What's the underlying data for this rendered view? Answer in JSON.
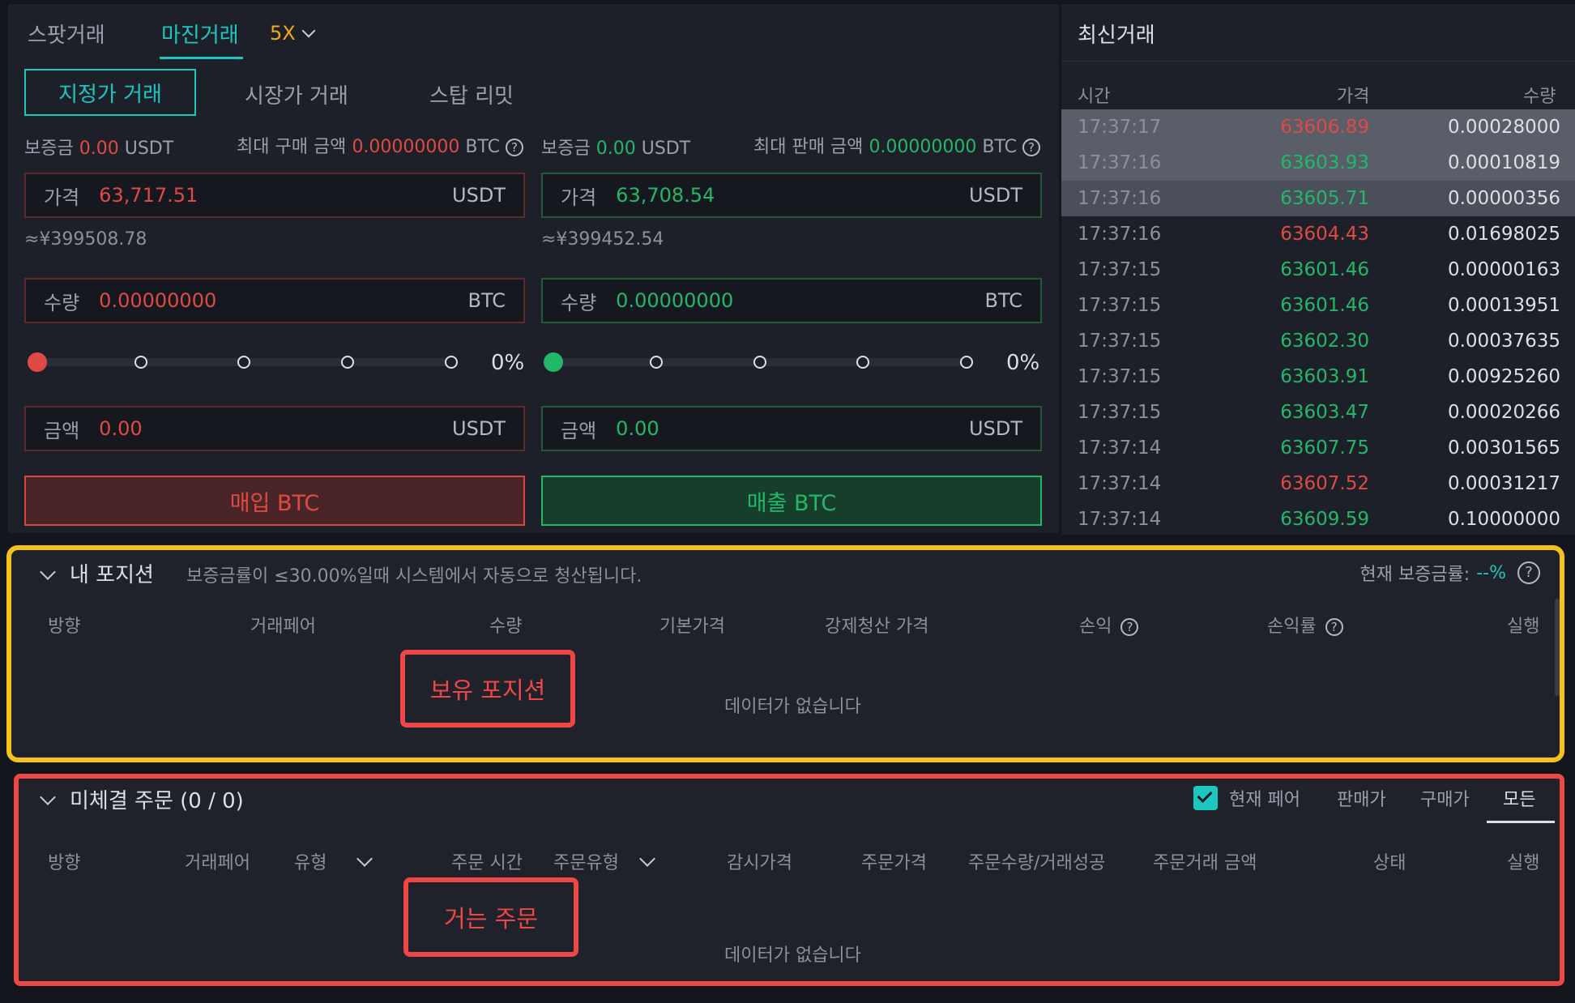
{
  "trade": {
    "tabs": {
      "spot": "스팟거래",
      "margin": "마진거래",
      "leverage": "5X"
    },
    "order_types": {
      "limit": "지정가 거래",
      "market": "시장가 거래",
      "stop_limit": "스탑 리밋"
    },
    "buy": {
      "margin_label": "보증금",
      "margin_value": "0.00",
      "margin_unit": "USDT",
      "max_label": "최대 구매 금액",
      "max_value": "0.00000000",
      "max_unit": "BTC",
      "price_label": "가격",
      "price_value": "63,717.51",
      "price_unit": "USDT",
      "approx": "≈¥399508.78",
      "qty_label": "수량",
      "qty_value": "0.00000000",
      "qty_unit": "BTC",
      "percent": "0%",
      "amount_label": "금액",
      "amount_value": "0.00",
      "amount_unit": "USDT",
      "button": "매입 BTC"
    },
    "sell": {
      "margin_label": "보증금",
      "margin_value": "0.00",
      "margin_unit": "USDT",
      "max_label": "최대 판매 금액",
      "max_value": "0.00000000",
      "max_unit": "BTC",
      "price_label": "가격",
      "price_value": "63,708.54",
      "price_unit": "USDT",
      "approx": "≈¥399452.54",
      "qty_label": "수량",
      "qty_value": "0.00000000",
      "qty_unit": "BTC",
      "percent": "0%",
      "amount_label": "금액",
      "amount_value": "0.00",
      "amount_unit": "USDT",
      "button": "매출 BTC"
    },
    "slider_percent": 0
  },
  "latest": {
    "title": "최신거래",
    "headers": {
      "time": "시간",
      "price": "가격",
      "qty": "수량"
    },
    "rows": [
      {
        "time": "17:37:17",
        "price": "63606.89",
        "qty": "0.00028000",
        "side": "sell",
        "highlight": true
      },
      {
        "time": "17:37:16",
        "price": "63603.93",
        "qty": "0.00010819",
        "side": "buy",
        "highlight": true
      },
      {
        "time": "17:37:16",
        "price": "63605.71",
        "qty": "0.00000356",
        "side": "buy",
        "highlight": true
      },
      {
        "time": "17:37:16",
        "price": "63604.43",
        "qty": "0.01698025",
        "side": "sell",
        "highlight": false
      },
      {
        "time": "17:37:15",
        "price": "63601.46",
        "qty": "0.00000163",
        "side": "buy",
        "highlight": false
      },
      {
        "time": "17:37:15",
        "price": "63601.46",
        "qty": "0.00013951",
        "side": "buy",
        "highlight": false
      },
      {
        "time": "17:37:15",
        "price": "63602.30",
        "qty": "0.00037635",
        "side": "buy",
        "highlight": false
      },
      {
        "time": "17:37:15",
        "price": "63603.91",
        "qty": "0.00925260",
        "side": "buy",
        "highlight": false
      },
      {
        "time": "17:37:15",
        "price": "63603.47",
        "qty": "0.00020266",
        "side": "buy",
        "highlight": false
      },
      {
        "time": "17:37:14",
        "price": "63607.75",
        "qty": "0.00301565",
        "side": "buy",
        "highlight": false
      },
      {
        "time": "17:37:14",
        "price": "63607.52",
        "qty": "0.00031217",
        "side": "sell",
        "highlight": false
      },
      {
        "time": "17:37:14",
        "price": "63609.59",
        "qty": "0.10000000",
        "side": "buy",
        "highlight": false
      }
    ]
  },
  "positions": {
    "title": "내 포지션",
    "notice": "보증금률이 ≤30.00%일때 시스템에서 자동으로 청산됩니다.",
    "margin_rate_label": "현재 보증금률:",
    "margin_rate_value": "--%",
    "columns": [
      "방향",
      "거래페어",
      "수량",
      "기본가격",
      "강제청산 가격",
      "손익",
      "손익률",
      "실행"
    ],
    "empty": "데이터가 없습니다",
    "annotation": "보유 포지션"
  },
  "orders": {
    "title": "미체결 주문 (0 / 0)",
    "current_pair_label": "현재 페어",
    "current_pair_checked": true,
    "filters": [
      "판매가",
      "구매가",
      "모든"
    ],
    "columns": [
      "방향",
      "거래페어",
      "유형",
      "주문 시간",
      "주문유형",
      "감시가격",
      "주문가격",
      "주문수량/거래성공",
      "주문거래 금액",
      "상태",
      "실행"
    ],
    "empty": "데이터가 없습니다",
    "annotation": "거는 주문"
  },
  "colors": {
    "red": "#e04a44",
    "green": "#22b86a",
    "teal": "#1cc7c1",
    "yellow": "#f5c21b",
    "gold": "#f0a81c"
  }
}
